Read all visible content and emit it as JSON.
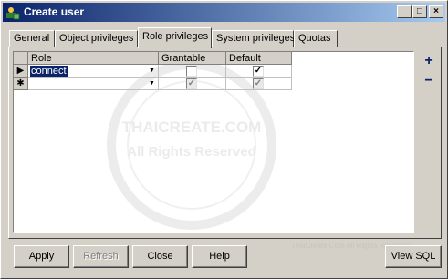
{
  "window": {
    "title": "Create user",
    "minimize_glyph": "_",
    "maximize_glyph": "□",
    "close_glyph": "×"
  },
  "tabs": [
    {
      "label": "General",
      "active": false
    },
    {
      "label": "Object privileges",
      "active": false
    },
    {
      "label": "Role privileges",
      "active": true
    },
    {
      "label": "System privileges",
      "active": false
    },
    {
      "label": "Quotas",
      "active": false
    }
  ],
  "grid": {
    "columns": [
      "Role",
      "Grantable",
      "Default"
    ],
    "rows": [
      {
        "indicator": "▶",
        "role": "connect",
        "grantable": false,
        "default": true,
        "new_row": false
      },
      {
        "indicator": "✱",
        "role": "",
        "grantable": true,
        "default": true,
        "new_row": true
      }
    ],
    "check_glyph": "✓",
    "dropdown_glyph": "▼"
  },
  "side_buttons": {
    "add": "+",
    "remove": "−"
  },
  "watermark": {
    "line1": "THAICREATE.COM",
    "line2": "All Rights Reserved"
  },
  "buttons": {
    "apply": "Apply",
    "refresh": "Refresh",
    "close": "Close",
    "help": "Help",
    "view_sql": "View SQL"
  },
  "footer_watermark": "ThaiCreate.Com All Rights Reserved"
}
